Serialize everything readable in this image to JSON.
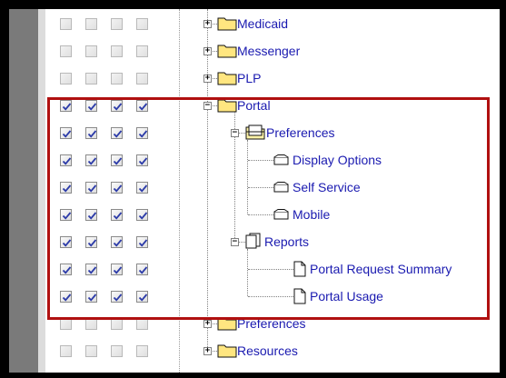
{
  "tree": {
    "nodes": [
      {
        "label": "Medicaid",
        "depth": 0,
        "kind": "folder",
        "expander": "+",
        "checked": false
      },
      {
        "label": "Messenger",
        "depth": 0,
        "kind": "folder",
        "expander": "+",
        "checked": false
      },
      {
        "label": "PLP",
        "depth": 0,
        "kind": "folder",
        "expander": "+",
        "checked": false
      },
      {
        "label": "Portal",
        "depth": 0,
        "kind": "folder",
        "expander": "−",
        "checked": true
      },
      {
        "label": "Preferences",
        "depth": 1,
        "kind": "folder-open",
        "expander": "−",
        "checked": true
      },
      {
        "label": "Display Options",
        "depth": 2,
        "kind": "menu-item",
        "expander": "",
        "checked": true
      },
      {
        "label": "Self Service",
        "depth": 2,
        "kind": "menu-item",
        "expander": "",
        "checked": true
      },
      {
        "label": "Mobile",
        "depth": 2,
        "kind": "menu-item",
        "expander": "",
        "checked": true
      },
      {
        "label": "Reports",
        "depth": 1,
        "kind": "report-group",
        "expander": "−",
        "checked": true
      },
      {
        "label": "Portal Request Summary",
        "depth": 2,
        "kind": "document",
        "expander": "",
        "checked": true
      },
      {
        "label": "Portal Usage",
        "depth": 2,
        "kind": "document",
        "expander": "",
        "checked": true
      },
      {
        "label": "Preferences",
        "depth": 0,
        "kind": "folder",
        "expander": "+",
        "checked": false
      },
      {
        "label": "Resources",
        "depth": 0,
        "kind": "folder",
        "expander": "+",
        "checked": false
      }
    ]
  },
  "permission_columns": 4,
  "colors": {
    "link": "#1a1ab0",
    "highlight": "#b01010",
    "folder": "#ffe680",
    "gutter": "#7a7a7a"
  }
}
